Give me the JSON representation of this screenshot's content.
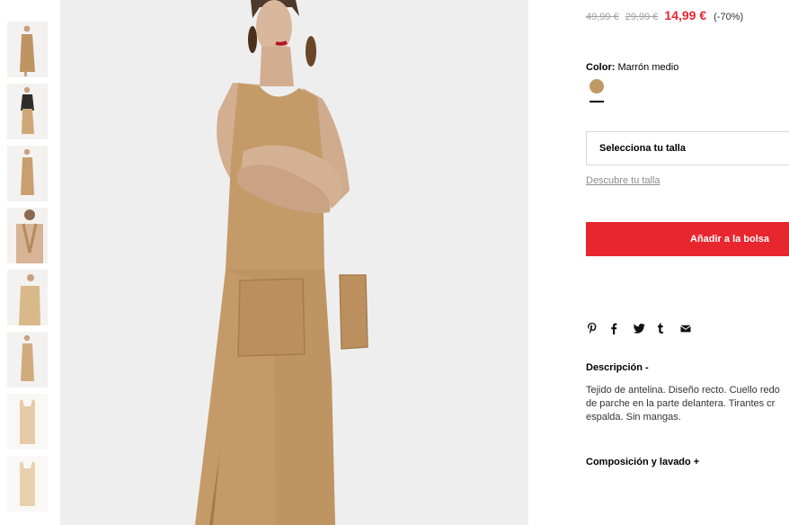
{
  "product": {
    "old_price_1": "49,99 €",
    "old_price_2": "29,99 €",
    "price": "14,99 €",
    "discount": "(-70%)",
    "color_label": "Color:",
    "color_name": "Marrón medio",
    "swatch_color": "#c09866",
    "size_select_label": "Selecciona tu talla",
    "size_guide_label": "Descubre tu talla",
    "add_to_bag_label": "Añadir a la bolsa",
    "description_title": "Descripción -",
    "description_lines": [
      "Tejido de antelina. Diseño recto. Cuello redo",
      "de parche en la parte delantera. Tirantes cr",
      "espalda. Sin mangas."
    ],
    "composition_title": "Composición y lavado +"
  },
  "share": {
    "icons": [
      "pinterest-icon",
      "facebook-icon",
      "twitter-icon",
      "tumblr-icon",
      "email-icon"
    ]
  },
  "gallery": {
    "thumbnail_count": 8,
    "dress_color": "#c49a68",
    "accent_color": "#e8262e"
  }
}
